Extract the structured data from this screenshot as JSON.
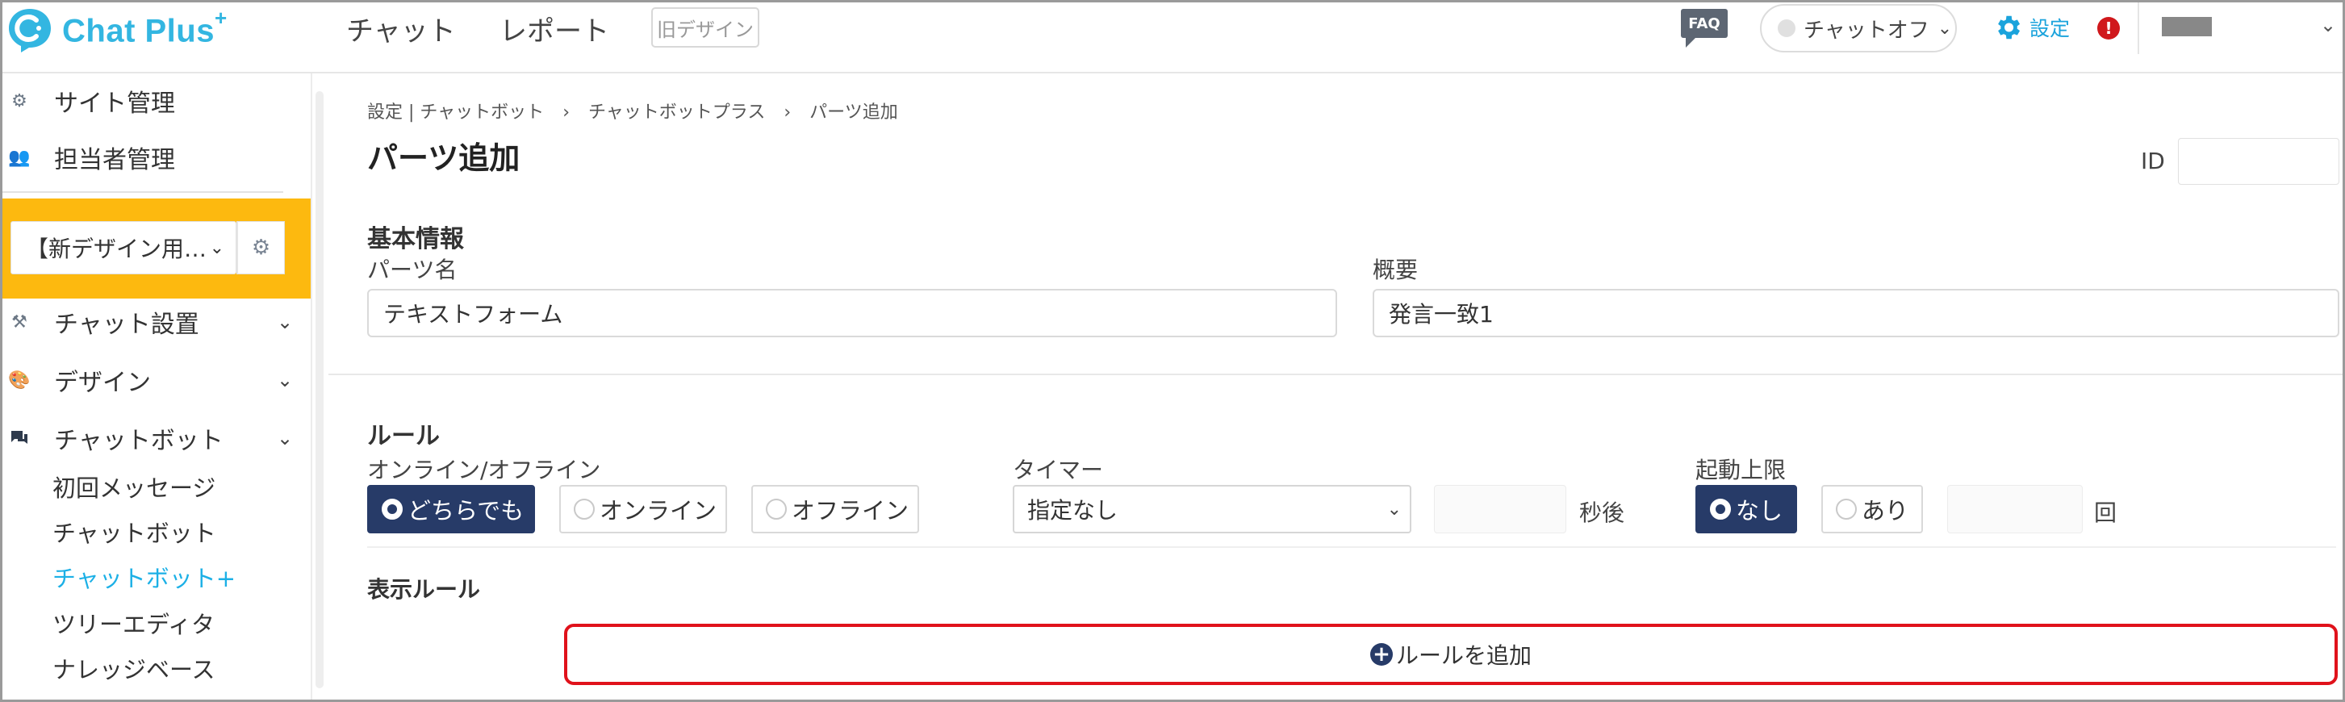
{
  "header": {
    "logo_text": "Chat Plus",
    "logo_sup": "+",
    "nav": [
      "チャット",
      "レポート"
    ],
    "old_design_label": "旧デザイン",
    "faq_label": "FAQ",
    "chat_status_label": "チャットオフ",
    "settings_label": "設定",
    "alert_icon": "!"
  },
  "sidebar": {
    "top_items": [
      {
        "label": "サイト管理",
        "icon": "gear-icon"
      },
      {
        "label": "担当者管理",
        "icon": "users-icon"
      }
    ],
    "site_select_label": "【新デザイン用…",
    "menu": [
      {
        "label": "チャット設置",
        "icon": "tools-icon"
      },
      {
        "label": "デザイン",
        "icon": "palette-icon"
      },
      {
        "label": "チャットボット",
        "icon": "chat-icon"
      }
    ],
    "submenu": [
      "初回メッセージ",
      "チャットボット",
      "チャットボット+",
      "ツリーエディタ",
      "ナレッジベース"
    ],
    "active_submenu": "チャットボット+"
  },
  "main": {
    "breadcrumb": [
      "設定 | チャットボット",
      "チャットボットプラス",
      "パーツ追加"
    ],
    "breadcrumb_sep": "›",
    "title": "パーツ追加",
    "id_label": "ID",
    "basic": {
      "title": "基本情報",
      "name_label": "パーツ名",
      "name_value": "テキストフォーム",
      "summary_label": "概要",
      "summary_value": "発言一致1"
    },
    "rules": {
      "title": "ルール",
      "online_label": "オンライン/オフライン",
      "online_options": [
        "どちらでも",
        "オンライン",
        "オフライン"
      ],
      "online_selected": 0,
      "timer_label": "タイマー",
      "timer_value": "指定なし",
      "timer_unit": "秒後",
      "limit_label": "起動上限",
      "limit_options": [
        "なし",
        "あり"
      ],
      "limit_selected": 0,
      "limit_unit": "回"
    },
    "display_rules": {
      "title": "表示ルール",
      "add_button": "ルールを追加"
    }
  },
  "colors": {
    "brand": "#33b6e1",
    "accent_yellow": "#fdb90f",
    "selected_navy": "#273b68",
    "highlight_red": "#e0121b",
    "alert_red": "#d0181c"
  }
}
